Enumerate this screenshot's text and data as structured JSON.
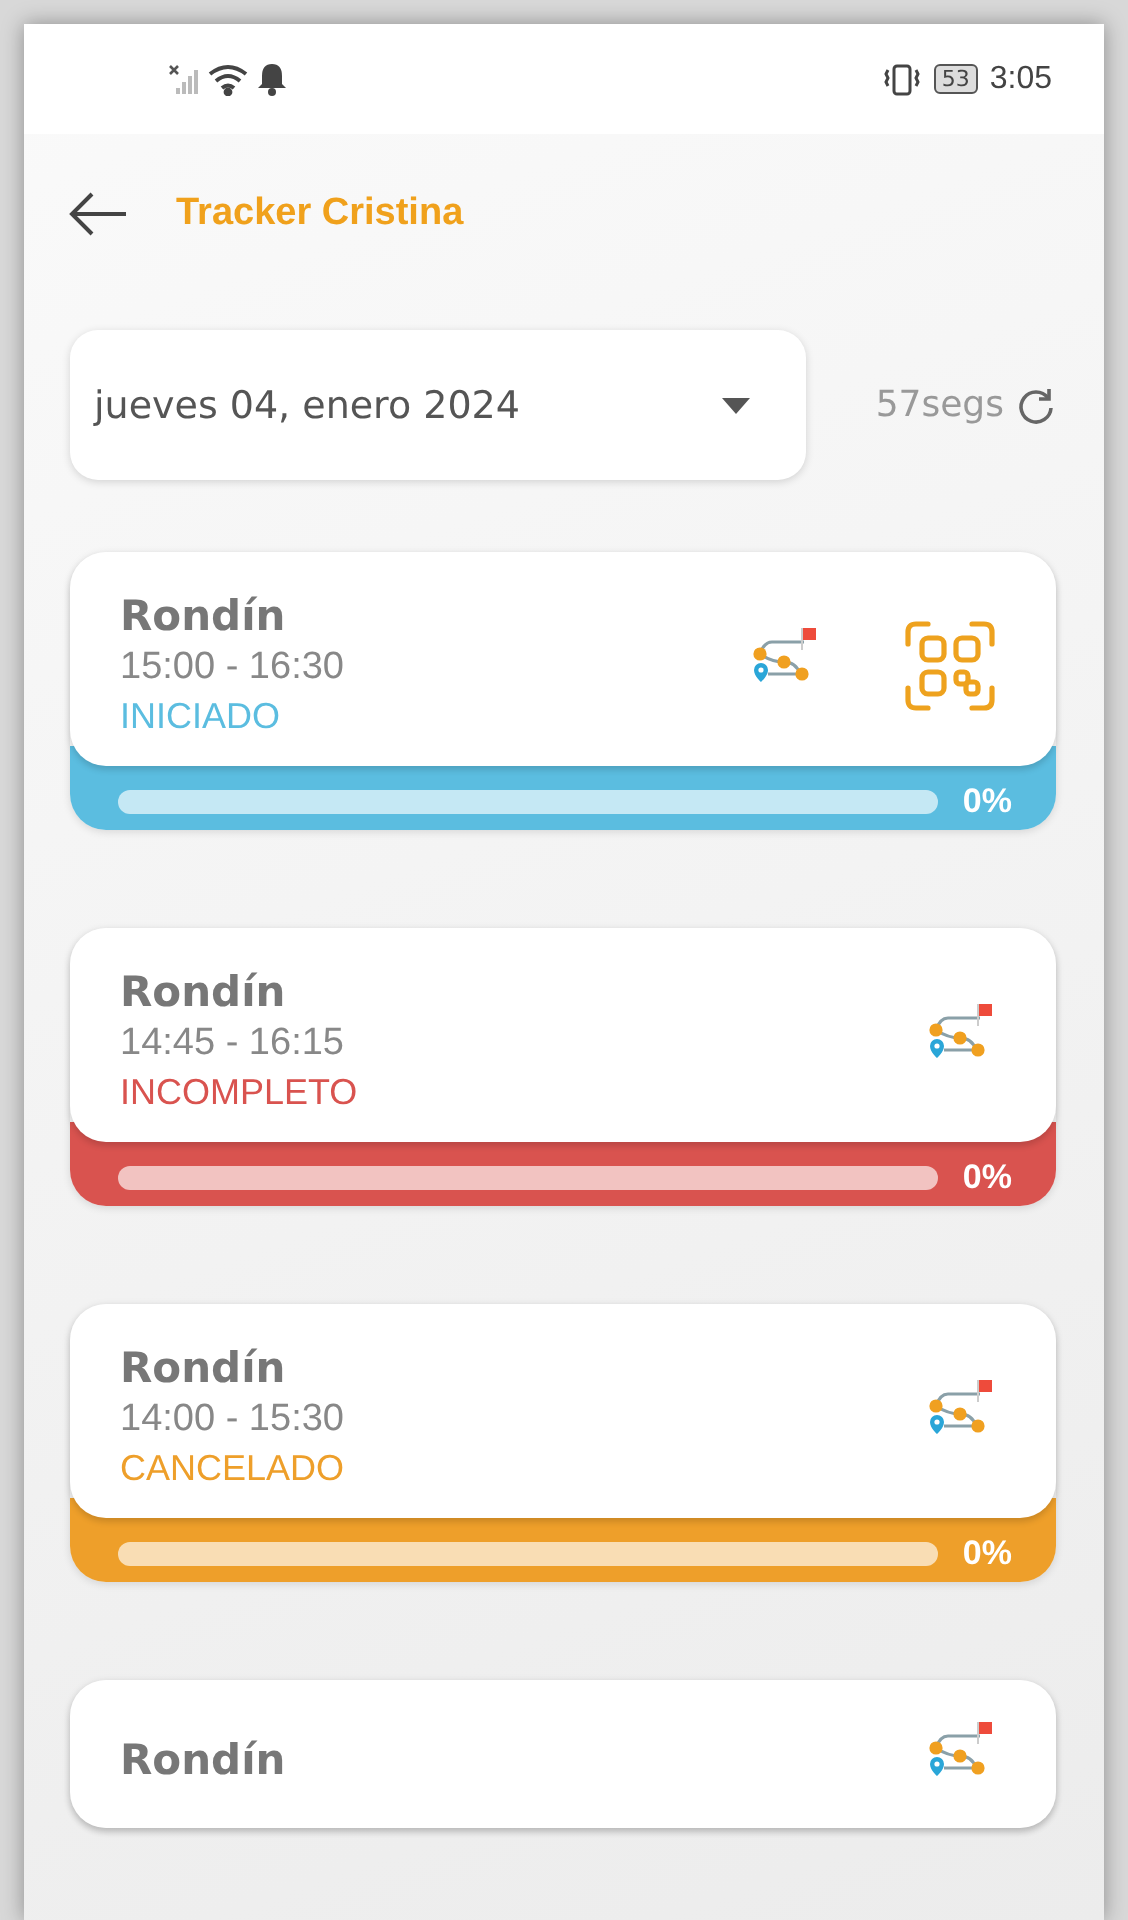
{
  "status_bar": {
    "battery": "53",
    "time": "3:05"
  },
  "header": {
    "title": "Tracker Cristina"
  },
  "date_picker": {
    "value": "jueves 04, enero 2024"
  },
  "refresh": {
    "label": "57segs"
  },
  "rounds": [
    {
      "title": "Rondín",
      "time": "15:00 - 16:30",
      "status": "INICIADO",
      "color": "#5bbde0",
      "qr": true,
      "level": 0,
      "progress": "0%"
    },
    {
      "title": "Rondín",
      "time": "14:45 - 16:15",
      "status": "INCOMPLETO",
      "color": "#d9534f",
      "qr": false,
      "level": 0,
      "progress": "0%"
    },
    {
      "title": "Rondín",
      "time": "14:00 - 15:30",
      "status": "CANCELADO",
      "color": "#ee9f2a",
      "qr": false,
      "level": 0,
      "progress": "0%"
    },
    {
      "title": "Rondín",
      "qr": false
    }
  ]
}
